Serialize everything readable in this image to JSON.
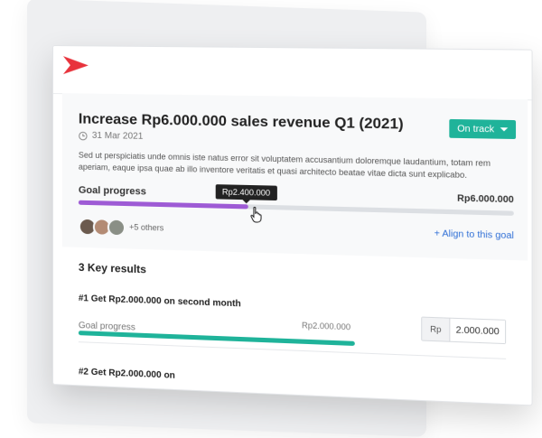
{
  "goal": {
    "title": "Increase Rp6.000.000 sales revenue Q1 (2021)",
    "date": "31 Mar 2021",
    "status": "On track",
    "description": "Sed ut perspiciatis unde omnis iste natus error sit voluptatem accusantium doloremque laudantium, totam rem aperiam, eaque ipsa quae ab illo inventore veritatis et quasi architecto beatae vitae dicta sunt explicabo.",
    "progress_label": "Goal progress",
    "target": "Rp6.000.000",
    "current": "Rp2.400.000",
    "progress_fraction": 0.4,
    "others": "+5 others",
    "align_link": "Align to this goal",
    "colors": {
      "progress": "#9e5bd5",
      "status": "#1fb39a",
      "link": "#2f6fd6",
      "logo": "#e8333c"
    }
  },
  "key_results": {
    "heading": "3 Key results",
    "items": [
      {
        "title": "#1 Get Rp2.000.000 on second month",
        "progress_label": "Goal progress",
        "target": "Rp2.000.000",
        "currency": "Rp",
        "value": "2.000.000",
        "progress_fraction": 1.0
      },
      {
        "title": "#2 Get Rp2.000.000 on"
      }
    ]
  },
  "icons": [
    "logo-icon",
    "clock-icon",
    "chevron-down-icon",
    "plus-icon",
    "pointer-cursor-icon"
  ]
}
